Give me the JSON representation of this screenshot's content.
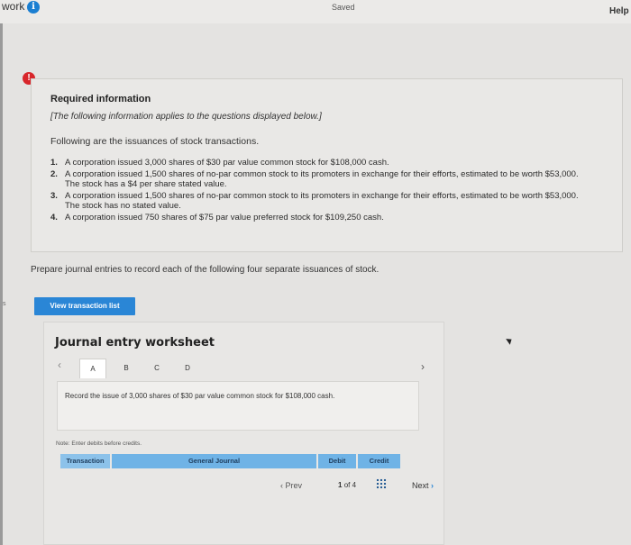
{
  "topbar": {
    "title": "work",
    "status": "Saved",
    "help_label": "Help"
  },
  "left_edge_text": "s",
  "required_info": {
    "title": "Required information",
    "subtitle": "[The following information applies to the questions displayed below.]",
    "intro": "Following are the issuances of stock transactions.",
    "items": [
      {
        "num": "1.",
        "text": "A corporation issued 3,000 shares of $30 par value common stock for $108,000 cash."
      },
      {
        "num": "2.",
        "text": "A corporation issued 1,500 shares of no-par common stock to its promoters in exchange for their efforts, estimated to be worth $53,000. The stock has a $4 per share stated value."
      },
      {
        "num": "3.",
        "text": "A corporation issued 1,500 shares of no-par common stock to its promoters in exchange for their efforts, estimated to be worth $53,000. The stock has no stated value."
      },
      {
        "num": "4.",
        "text": "A corporation issued 750 shares of $75 par value preferred stock for $109,250 cash."
      }
    ]
  },
  "prepare_text": "Prepare journal entries to record each of the following four separate issuances of stock.",
  "view_button_label": "View transaction list",
  "worksheet": {
    "title": "Journal entry worksheet",
    "tabs": [
      "A",
      "B",
      "C",
      "D"
    ],
    "instruction": "Record the issue of 3,000 shares of $30 par value common stock for $108,000 cash.",
    "note": "Note: Enter debits before credits.",
    "headers": {
      "transaction": "Transaction",
      "general_journal": "General Journal",
      "debit": "Debit",
      "credit": "Credit"
    },
    "pager": {
      "prev_label": "Prev",
      "current": "1",
      "of_label": "of",
      "total": "4",
      "next_label": "Next"
    }
  },
  "colors": {
    "accent": "#2a86d6",
    "alert": "#d8262b",
    "info": "#1b7fd1",
    "table_header": "#6fb3e6"
  }
}
